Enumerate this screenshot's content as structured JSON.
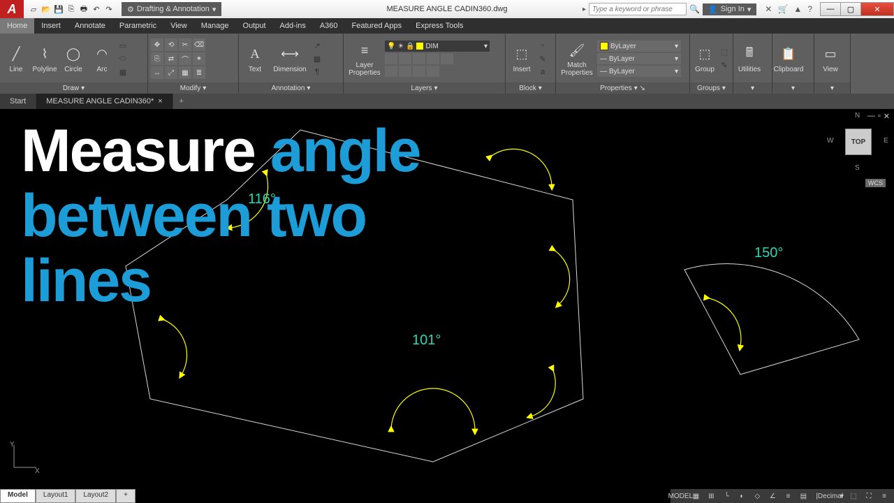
{
  "app_logo": "A",
  "workspace": "Drafting & Annotation",
  "document_title": "MEASURE ANGLE  CADIN360.dwg",
  "search_placeholder": "Type a keyword or phrase",
  "signin_label": "Sign In",
  "menu": [
    "Home",
    "Insert",
    "Annotate",
    "Parametric",
    "View",
    "Manage",
    "Output",
    "Add-ins",
    "A360",
    "Featured Apps",
    "Express Tools"
  ],
  "active_menu": "Home",
  "ribbon": {
    "draw": {
      "title": "Draw",
      "items": [
        "Line",
        "Polyline",
        "Circle",
        "Arc"
      ]
    },
    "modify": {
      "title": "Modify"
    },
    "annotation": {
      "title": "Annotation",
      "text": "Text",
      "dimension": "Dimension"
    },
    "layers": {
      "title": "Layers",
      "btn": "Layer\nProperties",
      "current": "DIM"
    },
    "block": {
      "title": "Block",
      "insert": "Insert"
    },
    "properties": {
      "title": "Properties",
      "match": "Match\nProperties",
      "rows": [
        "ByLayer",
        "ByLayer",
        "ByLayer"
      ]
    },
    "groups": {
      "title": "Groups",
      "btn": "Group"
    },
    "utilities": {
      "title": "Utilities"
    },
    "clipboard": {
      "title": "Clipboard"
    },
    "view": {
      "title": "View"
    }
  },
  "doctabs": {
    "start": "Start",
    "active": "MEASURE ANGLE  CADIN360*"
  },
  "viewcube": {
    "face": "TOP",
    "n": "N",
    "s": "S",
    "e": "E",
    "w": "W"
  },
  "wcs": "WCS",
  "angles": {
    "a1": "116°",
    "a2": "101°",
    "a3": "150°"
  },
  "overlay": {
    "l1a": "Measure ",
    "l1b": "angle",
    "l2": "between two",
    "l3": "lines"
  },
  "modeltabs": [
    "Model",
    "Layout1",
    "Layout2"
  ],
  "status": {
    "model": "MODEL",
    "units": "Decimal"
  }
}
